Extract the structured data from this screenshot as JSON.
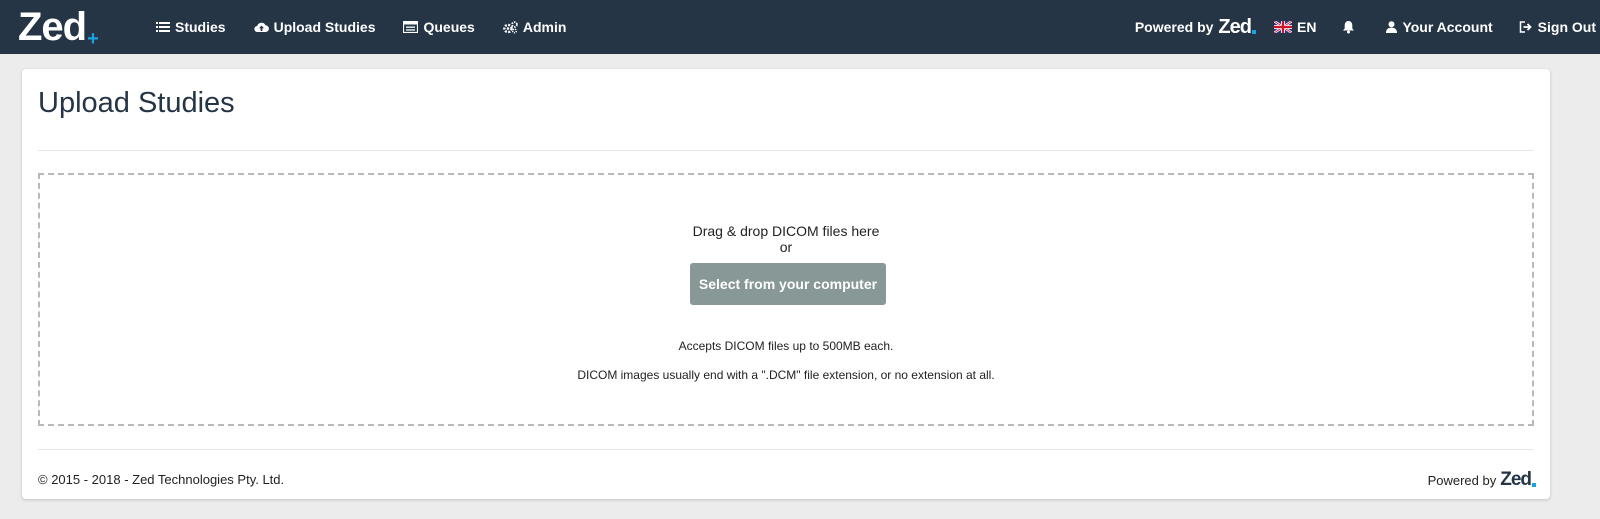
{
  "nav": {
    "brand": "Zed",
    "brand_accent": "+",
    "items": [
      {
        "label": "Studies",
        "icon": "list-icon"
      },
      {
        "label": "Upload Studies",
        "icon": "cloud-upload-icon"
      },
      {
        "label": "Queues",
        "icon": "queue-icon"
      },
      {
        "label": "Admin",
        "icon": "gears-icon"
      }
    ],
    "powered_by_label": "Powered by",
    "powered_by_brand": "Zed",
    "language": "EN",
    "language_icon": "uk-flag-icon",
    "notifications_icon": "bell-icon",
    "account_label": "Your Account",
    "signout_label": "Sign Out"
  },
  "page": {
    "title": "Upload Studies",
    "dropzone": {
      "line1": "Drag & drop DICOM files here",
      "line2": "or",
      "button_label": "Select from your computer",
      "note1": "Accepts DICOM files up to 500MB each.",
      "note2": "DICOM images usually end with a \".DCM\" file extension, or no extension at all."
    }
  },
  "footer": {
    "copyright": "© 2015 - 2018 - Zed Technologies Pty. Ltd.",
    "powered_by_label": "Powered by",
    "powered_by_brand": "Zed"
  },
  "colors": {
    "navbar_bg": "#253545",
    "accent": "#1aa3e0",
    "button_bg": "#879896",
    "page_bg": "#ececec"
  }
}
